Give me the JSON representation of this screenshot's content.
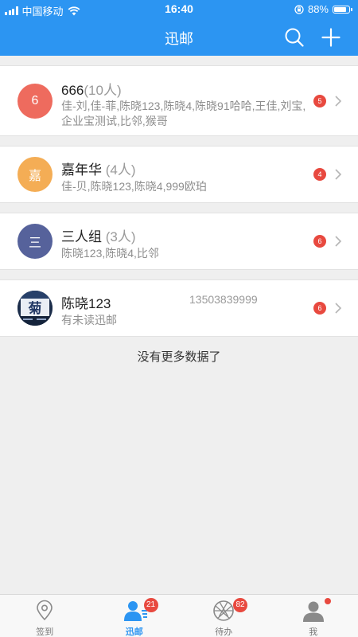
{
  "status_bar": {
    "carrier": "中国移动",
    "time": "16:40",
    "battery_text": "88%",
    "battery_level": 0.88
  },
  "nav": {
    "title": "迅邮",
    "search_icon": "search-icon",
    "add_icon": "plus-icon"
  },
  "conversations": [
    {
      "avatar_text": "6",
      "avatar_color": "#ee6b5e",
      "name": "666",
      "count": "(10人)",
      "members": "佳-刘,佳-菲,陈晓123,陈晓4,陈晓91哈哈,王佳,刘宝,企业宝测试,比邻,猴哥",
      "badge": "5"
    },
    {
      "avatar_text": "嘉",
      "avatar_color": "#f4ad55",
      "name": "嘉年华",
      "count": "(4人)",
      "members": "佳-贝,陈晓123,陈晓4,999欧珀",
      "badge": "4"
    },
    {
      "avatar_text": "三",
      "avatar_color": "#56629b",
      "name": "三人组",
      "count": "(3人)",
      "members": "陈晓123,陈晓4,比邻",
      "badge": "6"
    },
    {
      "name": "陈晓123",
      "phone": "13503839999",
      "members": "有未读迅邮",
      "badge": "6",
      "avatar_icon": "photo-avatar"
    }
  ],
  "footer_message": "没有更多数据了",
  "tabs": [
    {
      "label": "签到",
      "icon": "location-pin-icon",
      "active": false
    },
    {
      "label": "迅邮",
      "icon": "contacts-icon",
      "active": true,
      "badge": "21"
    },
    {
      "label": "待办",
      "icon": "shutter-icon",
      "active": false,
      "badge": "82"
    },
    {
      "label": "我",
      "icon": "user-icon",
      "active": false,
      "dot": true
    }
  ],
  "colors": {
    "brand": "#2c95f2",
    "badge": "#e8493f"
  }
}
